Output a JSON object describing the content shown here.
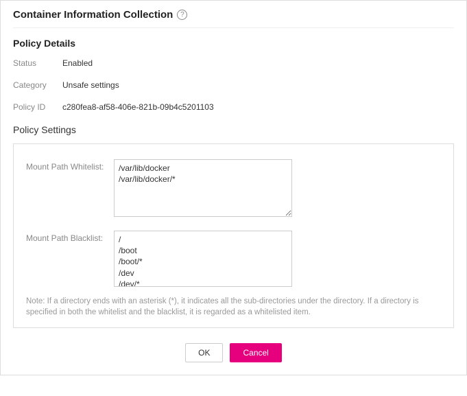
{
  "header": {
    "title": "Container Information Collection",
    "help_char": "?"
  },
  "policy_details": {
    "section_title": "Policy Details",
    "status_label": "Status",
    "status_value": "Enabled",
    "category_label": "Category",
    "category_value": "Unsafe settings",
    "policy_id_label": "Policy ID",
    "policy_id_value": "c280fea8-af58-406e-821b-09b4c5201103"
  },
  "policy_settings": {
    "section_title": "Policy Settings",
    "whitelist_label": "Mount Path Whitelist:",
    "whitelist_value": "/var/lib/docker\n/var/lib/docker/*",
    "blacklist_label": "Mount Path Blacklist:",
    "blacklist_value": "/\n/boot\n/boot/*\n/dev\n/dev/*\n/etc\n/etc/*",
    "note": "Note: If a directory ends with an asterisk (*), it indicates all the sub-directories under the directory. If a directory is specified in both the whitelist and the blacklist, it is regarded as a whitelisted item."
  },
  "footer": {
    "ok_label": "OK",
    "cancel_label": "Cancel"
  }
}
